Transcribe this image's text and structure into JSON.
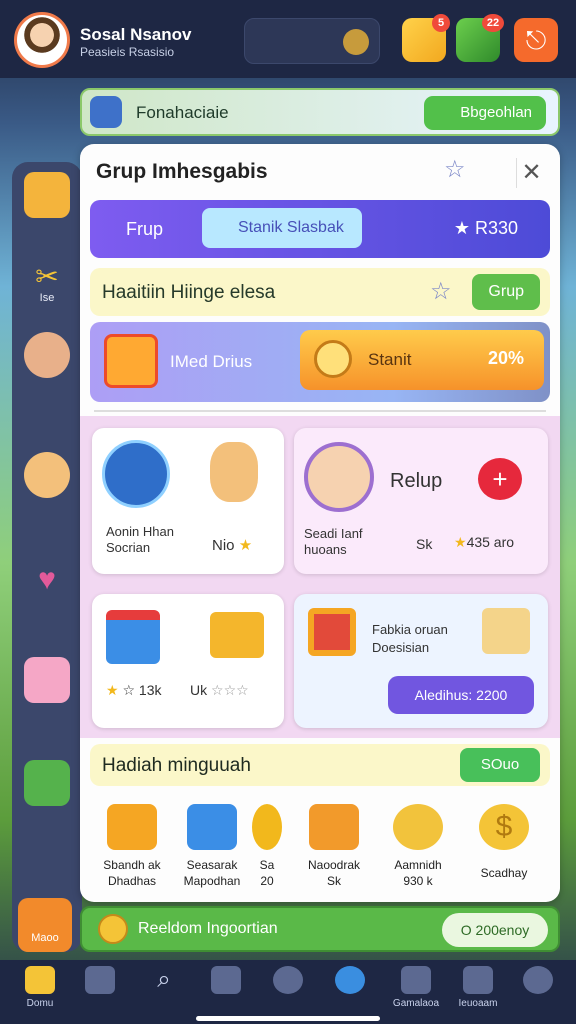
{
  "header": {
    "player_name": "Sosal Nsanov",
    "player_sub": "Peasieis Rsasisio",
    "badges": {
      "gift": "5",
      "cart": "22"
    }
  },
  "banner": {
    "text": "Fonahaciaie",
    "button": "Bbgeohlan"
  },
  "panel": {
    "title": "Grup Imhesgabis",
    "tabs": {
      "left": "Frup",
      "middle": "Stanik Slasbak",
      "right": "R330"
    },
    "section1": {
      "text": "Haaitiin Hiinge elesa",
      "button": "Grup"
    },
    "promo": {
      "text": "IMed Drius",
      "button_label": "Stanit",
      "percent": "20%"
    },
    "cards": {
      "c1": {
        "line1": "Aonin Hhan",
        "line2": "Socrian",
        "tag": "Nio"
      },
      "c2": {
        "title": "Relup",
        "line1": "Seadi Ianf",
        "line2": "huoans",
        "value1": "Sk",
        "value2": "435 aro"
      },
      "c3": {
        "left_val": "13k",
        "mid_val": "Uk"
      },
      "c4": {
        "line1": "Fabkia oruan",
        "line2": "Doesisian",
        "button": "Aledihus: 2200"
      }
    },
    "rewards": {
      "title": "Hadiah minguuah",
      "button": "SOuo",
      "items": [
        {
          "line1": "Sbandh ak",
          "line2": "Dhadhas"
        },
        {
          "line1": "Seasarak",
          "line2": "Mapodhan"
        },
        {
          "line1": "Sa",
          "line2": "20"
        },
        {
          "line1": "Naoodrak",
          "line2": "Sk"
        },
        {
          "line1": "Aamnidh",
          "line2": "930 k"
        },
        {
          "line1": "Scadhay",
          "line2": ""
        }
      ]
    }
  },
  "footer": {
    "text": "Reeldom Ingoortian",
    "button": "O 200enoy"
  },
  "left_menu": {
    "bottom_label": "Maoo"
  },
  "side": {
    "label1": "Ise"
  },
  "bottom_nav": [
    {
      "label": "Domu"
    },
    {
      "label": ""
    },
    {
      "label": ""
    },
    {
      "label": ""
    },
    {
      "label": ""
    },
    {
      "label": ""
    },
    {
      "label": "Gamalaoa"
    },
    {
      "label": "Ieuoaam"
    },
    {
      "label": ""
    }
  ],
  "colors": {
    "accent": "#7e5cf0",
    "green": "#5ab948",
    "orange": "#f28a2b",
    "navy": "#1e2744"
  }
}
